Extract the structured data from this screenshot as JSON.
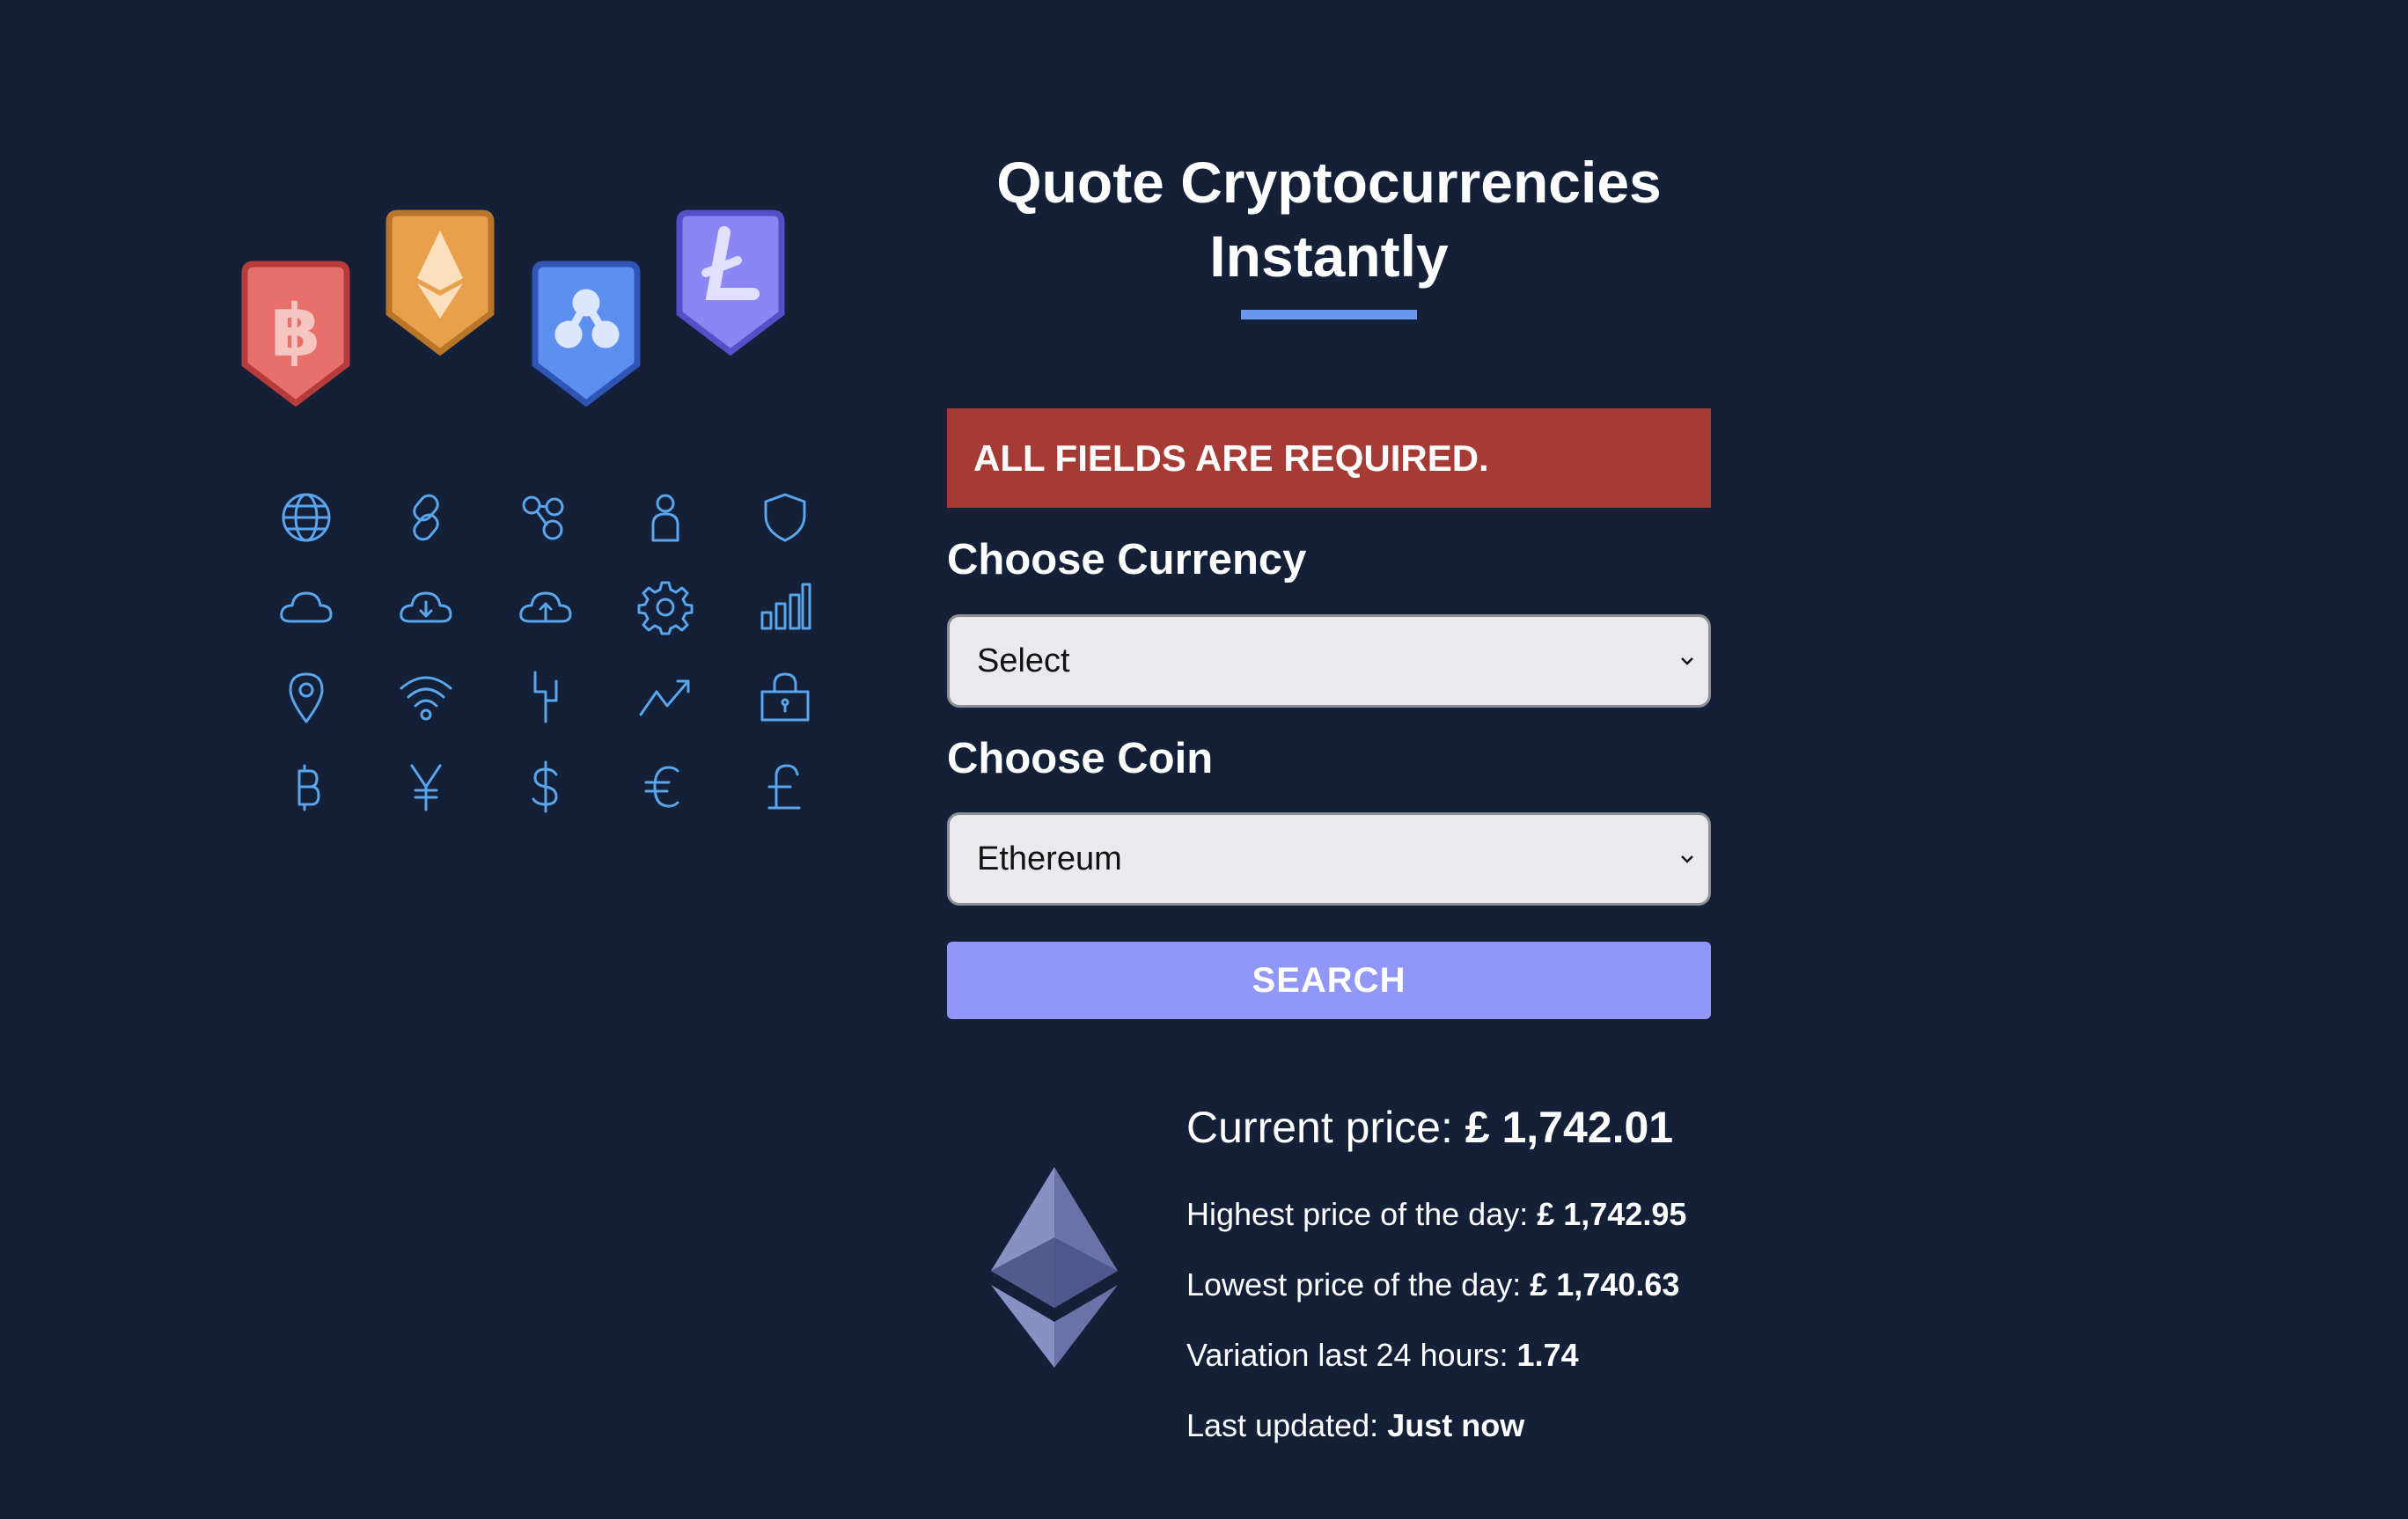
{
  "illustration": {
    "badges": [
      "bitcoin",
      "ethereum",
      "ripple",
      "litecoin"
    ],
    "badge_colors": {
      "bitcoin": "#e8706b",
      "ethereum": "#e9a04b",
      "ripple": "#5d8ff0",
      "litecoin": "#8a86f4"
    },
    "icons": [
      "globe-icon",
      "link-icon",
      "network-icon",
      "user-icon",
      "shield-icon",
      "cloud-icon",
      "cloud-download-icon",
      "cloud-upload-icon",
      "gear-icon",
      "bar-chart-icon",
      "location-pin-icon",
      "wifi-icon",
      "fork-icon",
      "trend-up-icon",
      "lock-icon",
      "bitcoin-symbol-icon",
      "yen-icon",
      "dollar-icon",
      "euro-icon",
      "pound-icon"
    ]
  },
  "title": "Quote Cryptocurrencies Instantly",
  "error_message": "ALL FIELDS ARE REQUIRED.",
  "form": {
    "currency_label": "Choose Currency",
    "currency_value": "Select",
    "coin_label": "Choose Coin",
    "coin_value": "Ethereum",
    "search_label": "SEARCH"
  },
  "result": {
    "current_label": "Current price: ",
    "current_value": "£ 1,742.01",
    "high_label": "Highest price of the day: ",
    "high_value": "£ 1,742.95",
    "low_label": "Lowest price of the day: ",
    "low_value": "£ 1,740.63",
    "variation_label": "Variation last 24 hours: ",
    "variation_value": "1.74",
    "updated_label": "Last updated: ",
    "updated_value": "Just now"
  },
  "colors": {
    "background": "#132037",
    "error": "#a63b36",
    "button": "#9197f7",
    "underline": "#6a98ee",
    "icon_stroke": "#5aa5ec"
  }
}
